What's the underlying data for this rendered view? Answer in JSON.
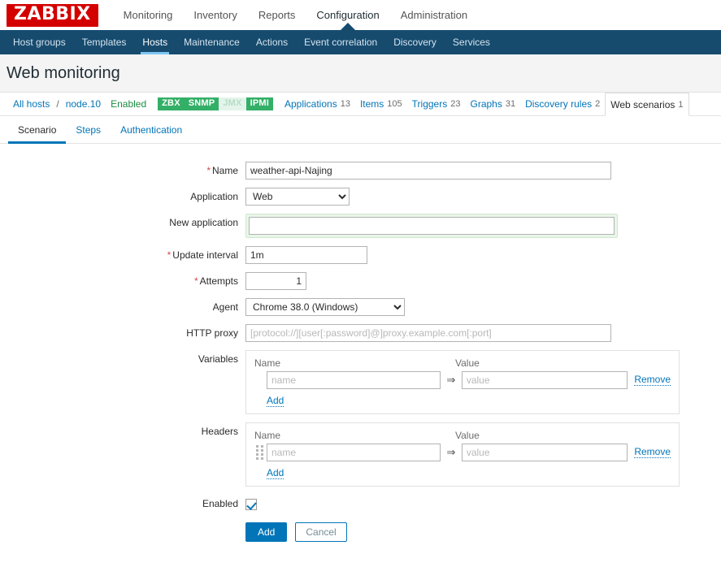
{
  "brand": {
    "logo_text": "ZABBIX",
    "logo_bg": "#d40000",
    "accent": "#0275b8"
  },
  "topnav": {
    "items": [
      {
        "label": "Monitoring",
        "active": false
      },
      {
        "label": "Inventory",
        "active": false
      },
      {
        "label": "Reports",
        "active": false
      },
      {
        "label": "Configuration",
        "active": true
      },
      {
        "label": "Administration",
        "active": false
      }
    ]
  },
  "subnav": {
    "items": [
      {
        "label": "Host groups",
        "active": false
      },
      {
        "label": "Templates",
        "active": false
      },
      {
        "label": "Hosts",
        "active": true
      },
      {
        "label": "Maintenance",
        "active": false
      },
      {
        "label": "Actions",
        "active": false
      },
      {
        "label": "Event correlation",
        "active": false
      },
      {
        "label": "Discovery",
        "active": false
      },
      {
        "label": "Services",
        "active": false
      }
    ]
  },
  "page": {
    "title": "Web monitoring"
  },
  "breadcrumb": {
    "all_hosts": "All hosts",
    "separator": "/",
    "host": "node.10",
    "status": "Enabled",
    "badges": [
      {
        "label": "ZBX",
        "enabled": true
      },
      {
        "label": "SNMP",
        "enabled": true
      },
      {
        "label": "JMX",
        "enabled": false
      },
      {
        "label": "IPMI",
        "enabled": true
      }
    ],
    "links": [
      {
        "label": "Applications",
        "count": "13",
        "selected": false
      },
      {
        "label": "Items",
        "count": "105",
        "selected": false
      },
      {
        "label": "Triggers",
        "count": "23",
        "selected": false
      },
      {
        "label": "Graphs",
        "count": "31",
        "selected": false
      },
      {
        "label": "Discovery rules",
        "count": "2",
        "selected": false
      },
      {
        "label": "Web scenarios",
        "count": "1",
        "selected": true
      }
    ]
  },
  "form_tabs": [
    {
      "label": "Scenario",
      "active": true
    },
    {
      "label": "Steps",
      "active": false
    },
    {
      "label": "Authentication",
      "active": false
    }
  ],
  "form": {
    "name": {
      "label": "Name",
      "required": true,
      "value": "weather-api-Najing"
    },
    "application": {
      "label": "Application",
      "required": false,
      "value": "Web",
      "options": [
        "Web"
      ]
    },
    "new_application": {
      "label": "New application",
      "required": false,
      "value": "",
      "focused": true
    },
    "update_interval": {
      "label": "Update interval",
      "required": true,
      "value": "1m"
    },
    "attempts": {
      "label": "Attempts",
      "required": true,
      "value": "1"
    },
    "agent": {
      "label": "Agent",
      "required": false,
      "value": "Chrome 38.0 (Windows)",
      "options": [
        "Chrome 38.0 (Windows)"
      ]
    },
    "http_proxy": {
      "label": "HTTP proxy",
      "required": false,
      "value": "",
      "placeholder": "[protocol://][user[:password]@]proxy.example.com[:port]"
    },
    "variables": {
      "label": "Variables",
      "col_name": "Name",
      "col_value": "Value",
      "arrow": "⇒",
      "rows": [
        {
          "name": "",
          "name_placeholder": "name",
          "value": "",
          "value_placeholder": "value",
          "remove_label": "Remove",
          "draggable": false
        }
      ],
      "add_label": "Add"
    },
    "headers": {
      "label": "Headers",
      "col_name": "Name",
      "col_value": "Value",
      "arrow": "⇒",
      "rows": [
        {
          "name": "",
          "name_placeholder": "name",
          "value": "",
          "value_placeholder": "value",
          "remove_label": "Remove",
          "draggable": true
        }
      ],
      "add_label": "Add"
    },
    "enabled": {
      "label": "Enabled",
      "checked": true
    },
    "buttons": {
      "submit": "Add",
      "cancel": "Cancel"
    }
  }
}
